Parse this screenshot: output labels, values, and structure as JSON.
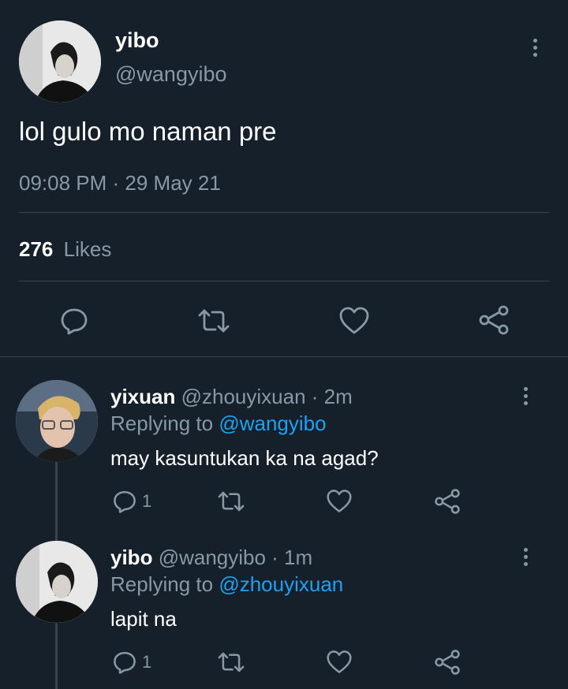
{
  "tweet": {
    "display_name": "yibo",
    "handle": "@wangyibo",
    "text": "lol gulo mo naman pre",
    "timestamp": "09:08 PM · 29 May 21",
    "likes_count": "276",
    "likes_label": "Likes"
  },
  "replies": [
    {
      "display_name": "yixuan",
      "handle": "@zhouyixuan",
      "time": "· 2m",
      "replying_prefix": "Replying to",
      "replying_to": "@wangyibo",
      "text": "may kasuntukan ka na agad?",
      "reply_count": "1"
    },
    {
      "display_name": "yibo",
      "handle": "@wangyibo",
      "time": "· 1m",
      "replying_prefix": "Replying to",
      "replying_to": "@zhouyixuan",
      "text": "lapit na",
      "reply_count": "1"
    }
  ],
  "icons": {
    "reply": "comment-bubble-icon",
    "retweet": "retweet-arrows-icon",
    "like": "heart-icon",
    "share": "share-nodes-icon",
    "more": "vertical-dots-icon"
  },
  "colors": {
    "background": "#15202b",
    "text": "#ffffff",
    "muted": "#8899a6",
    "link": "#1da1f2",
    "divider": "#38444d"
  }
}
